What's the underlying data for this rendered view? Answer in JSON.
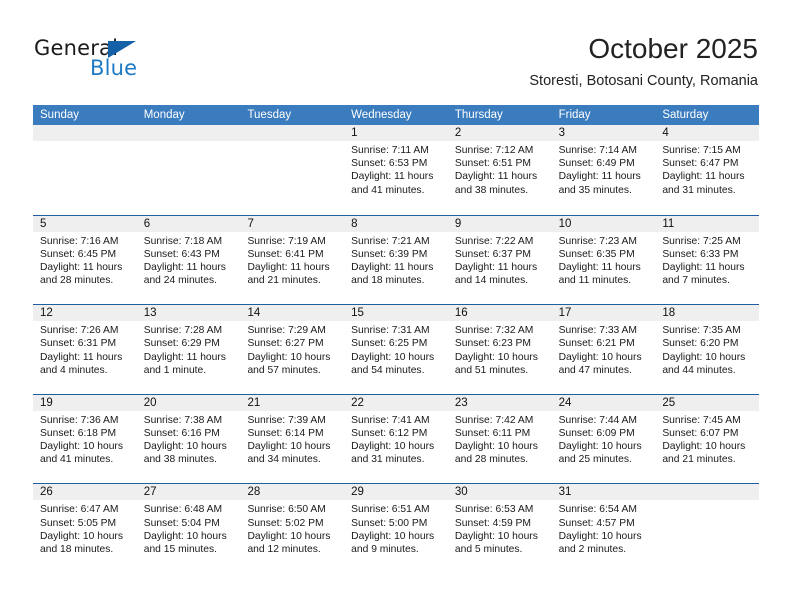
{
  "brand": {
    "name_top": "General",
    "name_bottom": "Blue",
    "accent_color": "#1f7ac4",
    "triangle_color": "#1461a8"
  },
  "header": {
    "month_title": "October 2025",
    "location": "Storesti, Botosani County, Romania"
  },
  "calendar": {
    "header_bg": "#3a7cbe",
    "day_band_bg": "#efefef",
    "row_divider_color": "#1f5fa0",
    "weekday_headers": [
      "Sunday",
      "Monday",
      "Tuesday",
      "Wednesday",
      "Thursday",
      "Friday",
      "Saturday"
    ],
    "weeks": [
      [
        {
          "day": "",
          "sunrise": "",
          "sunset": "",
          "daylight_1": "",
          "daylight_2": "",
          "empty": true
        },
        {
          "day": "",
          "sunrise": "",
          "sunset": "",
          "daylight_1": "",
          "daylight_2": "",
          "empty": true
        },
        {
          "day": "",
          "sunrise": "",
          "sunset": "",
          "daylight_1": "",
          "daylight_2": "",
          "empty": true
        },
        {
          "day": "1",
          "sunrise": "Sunrise: 7:11 AM",
          "sunset": "Sunset: 6:53 PM",
          "daylight_1": "Daylight: 11 hours",
          "daylight_2": "and 41 minutes."
        },
        {
          "day": "2",
          "sunrise": "Sunrise: 7:12 AM",
          "sunset": "Sunset: 6:51 PM",
          "daylight_1": "Daylight: 11 hours",
          "daylight_2": "and 38 minutes."
        },
        {
          "day": "3",
          "sunrise": "Sunrise: 7:14 AM",
          "sunset": "Sunset: 6:49 PM",
          "daylight_1": "Daylight: 11 hours",
          "daylight_2": "and 35 minutes."
        },
        {
          "day": "4",
          "sunrise": "Sunrise: 7:15 AM",
          "sunset": "Sunset: 6:47 PM",
          "daylight_1": "Daylight: 11 hours",
          "daylight_2": "and 31 minutes."
        }
      ],
      [
        {
          "day": "5",
          "sunrise": "Sunrise: 7:16 AM",
          "sunset": "Sunset: 6:45 PM",
          "daylight_1": "Daylight: 11 hours",
          "daylight_2": "and 28 minutes."
        },
        {
          "day": "6",
          "sunrise": "Sunrise: 7:18 AM",
          "sunset": "Sunset: 6:43 PM",
          "daylight_1": "Daylight: 11 hours",
          "daylight_2": "and 24 minutes."
        },
        {
          "day": "7",
          "sunrise": "Sunrise: 7:19 AM",
          "sunset": "Sunset: 6:41 PM",
          "daylight_1": "Daylight: 11 hours",
          "daylight_2": "and 21 minutes."
        },
        {
          "day": "8",
          "sunrise": "Sunrise: 7:21 AM",
          "sunset": "Sunset: 6:39 PM",
          "daylight_1": "Daylight: 11 hours",
          "daylight_2": "and 18 minutes."
        },
        {
          "day": "9",
          "sunrise": "Sunrise: 7:22 AM",
          "sunset": "Sunset: 6:37 PM",
          "daylight_1": "Daylight: 11 hours",
          "daylight_2": "and 14 minutes."
        },
        {
          "day": "10",
          "sunrise": "Sunrise: 7:23 AM",
          "sunset": "Sunset: 6:35 PM",
          "daylight_1": "Daylight: 11 hours",
          "daylight_2": "and 11 minutes."
        },
        {
          "day": "11",
          "sunrise": "Sunrise: 7:25 AM",
          "sunset": "Sunset: 6:33 PM",
          "daylight_1": "Daylight: 11 hours",
          "daylight_2": "and 7 minutes."
        }
      ],
      [
        {
          "day": "12",
          "sunrise": "Sunrise: 7:26 AM",
          "sunset": "Sunset: 6:31 PM",
          "daylight_1": "Daylight: 11 hours",
          "daylight_2": "and 4 minutes."
        },
        {
          "day": "13",
          "sunrise": "Sunrise: 7:28 AM",
          "sunset": "Sunset: 6:29 PM",
          "daylight_1": "Daylight: 11 hours",
          "daylight_2": "and 1 minute."
        },
        {
          "day": "14",
          "sunrise": "Sunrise: 7:29 AM",
          "sunset": "Sunset: 6:27 PM",
          "daylight_1": "Daylight: 10 hours",
          "daylight_2": "and 57 minutes."
        },
        {
          "day": "15",
          "sunrise": "Sunrise: 7:31 AM",
          "sunset": "Sunset: 6:25 PM",
          "daylight_1": "Daylight: 10 hours",
          "daylight_2": "and 54 minutes."
        },
        {
          "day": "16",
          "sunrise": "Sunrise: 7:32 AM",
          "sunset": "Sunset: 6:23 PM",
          "daylight_1": "Daylight: 10 hours",
          "daylight_2": "and 51 minutes."
        },
        {
          "day": "17",
          "sunrise": "Sunrise: 7:33 AM",
          "sunset": "Sunset: 6:21 PM",
          "daylight_1": "Daylight: 10 hours",
          "daylight_2": "and 47 minutes."
        },
        {
          "day": "18",
          "sunrise": "Sunrise: 7:35 AM",
          "sunset": "Sunset: 6:20 PM",
          "daylight_1": "Daylight: 10 hours",
          "daylight_2": "and 44 minutes."
        }
      ],
      [
        {
          "day": "19",
          "sunrise": "Sunrise: 7:36 AM",
          "sunset": "Sunset: 6:18 PM",
          "daylight_1": "Daylight: 10 hours",
          "daylight_2": "and 41 minutes."
        },
        {
          "day": "20",
          "sunrise": "Sunrise: 7:38 AM",
          "sunset": "Sunset: 6:16 PM",
          "daylight_1": "Daylight: 10 hours",
          "daylight_2": "and 38 minutes."
        },
        {
          "day": "21",
          "sunrise": "Sunrise: 7:39 AM",
          "sunset": "Sunset: 6:14 PM",
          "daylight_1": "Daylight: 10 hours",
          "daylight_2": "and 34 minutes."
        },
        {
          "day": "22",
          "sunrise": "Sunrise: 7:41 AM",
          "sunset": "Sunset: 6:12 PM",
          "daylight_1": "Daylight: 10 hours",
          "daylight_2": "and 31 minutes."
        },
        {
          "day": "23",
          "sunrise": "Sunrise: 7:42 AM",
          "sunset": "Sunset: 6:11 PM",
          "daylight_1": "Daylight: 10 hours",
          "daylight_2": "and 28 minutes."
        },
        {
          "day": "24",
          "sunrise": "Sunrise: 7:44 AM",
          "sunset": "Sunset: 6:09 PM",
          "daylight_1": "Daylight: 10 hours",
          "daylight_2": "and 25 minutes."
        },
        {
          "day": "25",
          "sunrise": "Sunrise: 7:45 AM",
          "sunset": "Sunset: 6:07 PM",
          "daylight_1": "Daylight: 10 hours",
          "daylight_2": "and 21 minutes."
        }
      ],
      [
        {
          "day": "26",
          "sunrise": "Sunrise: 6:47 AM",
          "sunset": "Sunset: 5:05 PM",
          "daylight_1": "Daylight: 10 hours",
          "daylight_2": "and 18 minutes."
        },
        {
          "day": "27",
          "sunrise": "Sunrise: 6:48 AM",
          "sunset": "Sunset: 5:04 PM",
          "daylight_1": "Daylight: 10 hours",
          "daylight_2": "and 15 minutes."
        },
        {
          "day": "28",
          "sunrise": "Sunrise: 6:50 AM",
          "sunset": "Sunset: 5:02 PM",
          "daylight_1": "Daylight: 10 hours",
          "daylight_2": "and 12 minutes."
        },
        {
          "day": "29",
          "sunrise": "Sunrise: 6:51 AM",
          "sunset": "Sunset: 5:00 PM",
          "daylight_1": "Daylight: 10 hours",
          "daylight_2": "and 9 minutes."
        },
        {
          "day": "30",
          "sunrise": "Sunrise: 6:53 AM",
          "sunset": "Sunset: 4:59 PM",
          "daylight_1": "Daylight: 10 hours",
          "daylight_2": "and 5 minutes."
        },
        {
          "day": "31",
          "sunrise": "Sunrise: 6:54 AM",
          "sunset": "Sunset: 4:57 PM",
          "daylight_1": "Daylight: 10 hours",
          "daylight_2": "and 2 minutes."
        },
        {
          "day": "",
          "sunrise": "",
          "sunset": "",
          "daylight_1": "",
          "daylight_2": "",
          "empty": true
        }
      ]
    ]
  }
}
